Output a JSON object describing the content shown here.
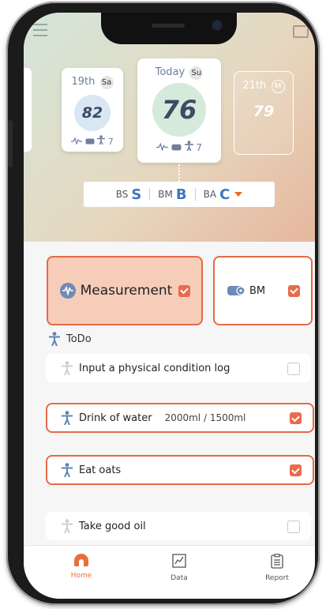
{
  "calendar": {
    "prev_day": {
      "date": "19th",
      "dow": "Sa",
      "score": "82",
      "stats": "7"
    },
    "today": {
      "date": "Today",
      "dow": "Su",
      "score": "76",
      "stats": "7"
    },
    "next_day": {
      "date": "21th",
      "dow": "M",
      "score": "79"
    },
    "legend": [
      {
        "label": "BS",
        "value": "S"
      },
      {
        "label": "BM",
        "value": "B"
      },
      {
        "label": "BA",
        "value": "C"
      }
    ]
  },
  "cards": {
    "measurement": {
      "label": "Measurement",
      "checked": true
    },
    "bm": {
      "label": "BM",
      "checked": true
    }
  },
  "todo": {
    "title": "ToDo",
    "items": [
      {
        "label": "Input a physical condition log",
        "checked": false
      },
      {
        "label": "Drink of water",
        "amount": "2000ml / 1500ml",
        "checked": true
      },
      {
        "label": "Eat oats",
        "checked": true
      },
      {
        "label": "Take good oil",
        "checked": false
      }
    ]
  },
  "nav": {
    "home": "Home",
    "data": "Data",
    "report": "Report"
  },
  "colors": {
    "accent": "#e56a46",
    "score_blue": "#3d78c1",
    "active_tab": "#e76e3c"
  }
}
